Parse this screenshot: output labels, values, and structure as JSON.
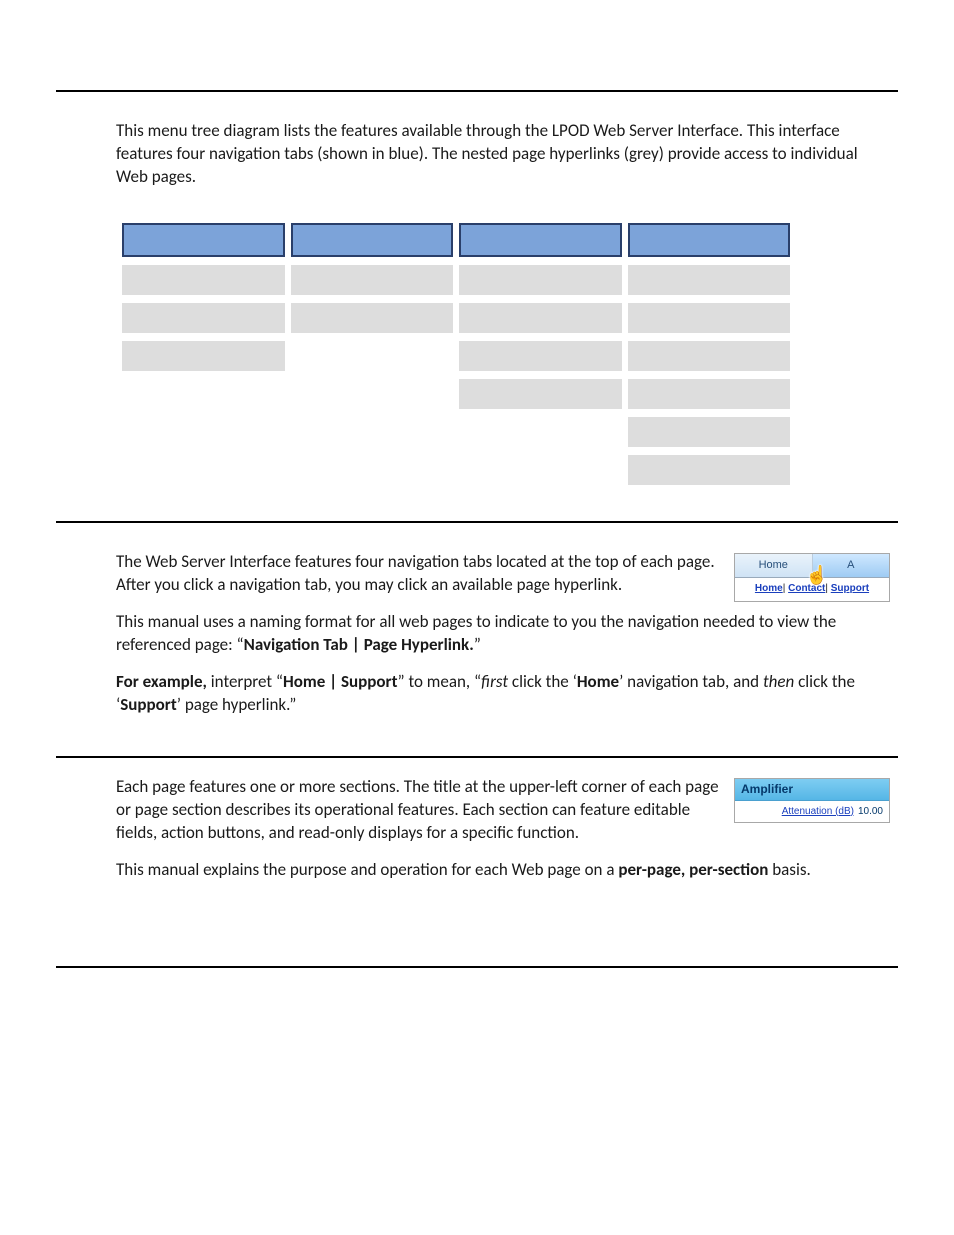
{
  "intro": "This menu tree diagram lists the features available through the LPOD Web Server Interface. This interface features four navigation tabs (shown in blue). The nested page hyperlinks (grey) provide access to individual Web pages.",
  "tree": {
    "headers": [
      "",
      "",
      "",
      ""
    ],
    "rows": [
      [
        "sub",
        "sub",
        "sub",
        "sub"
      ],
      [
        "sub",
        "sub",
        "sub",
        "sub"
      ],
      [
        "sub",
        "empty",
        "sub",
        "sub"
      ],
      [
        "empty",
        "empty",
        "sub",
        "sub"
      ],
      [
        "empty",
        "empty",
        "empty",
        "sub"
      ],
      [
        "empty",
        "empty",
        "empty",
        "sub"
      ]
    ]
  },
  "nav_section": {
    "p1": "The Web Server Interface features four navigation tabs located at the top of each page. After you click a navigation tab, you may click an available page hyperlink.",
    "p2a": "This manual uses a naming format for all web pages to indicate to you the navigation needed to view the referenced page: “",
    "p2b": "Navigation Tab | Page Hyperlink.",
    "p2c": "”",
    "p3a": "For example,",
    "p3b": " interpret “",
    "p3c": "Home | Support",
    "p3d": "” to mean, “",
    "p3e": "first",
    "p3f": " click the ‘",
    "p3g": "Home",
    "p3h": "’ navigation tab, and ",
    "p3i": "then",
    "p3j": " click the ‘",
    "p3k": "Support",
    "p3l": "’ page hyperlink.”"
  },
  "thumb1": {
    "tab_home": "Home",
    "tab_a": "A",
    "link_home": "Home",
    "sep": "| ",
    "link_contact": "Contact",
    "link_support": "Support"
  },
  "sections_section": {
    "p1": "Each page features one or more sections. The title at the upper-left corner of each page or page section describes its operational features. Each section can feature editable fields, action buttons, and read-only displays for a specific function.",
    "p2a": "This manual explains the purpose and operation for each Web page on a ",
    "p2b": "per-page, per-section",
    "p2c": " basis."
  },
  "thumb2": {
    "header": "Amplifier",
    "key": "Attenuation (dB)",
    "val": "10.00"
  }
}
